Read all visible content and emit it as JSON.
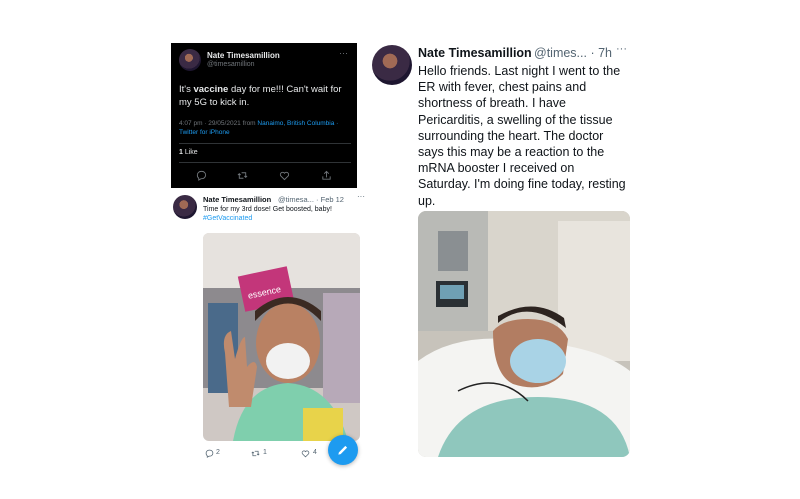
{
  "dark_tweet": {
    "name": "Nate Timesamillion",
    "handle": "@timesamillion",
    "text_before": "It's ",
    "text_bold": "vaccine",
    "text_after": " day for me!!! Can't wait for my 5G to kick in.",
    "meta_time": "4:07 pm · 29/05/2021 from ",
    "meta_location": "Nanaimo, British Columbia",
    "meta_source": " · Twitter for iPhone",
    "likes_count": "1",
    "likes_label": "Like",
    "more_icon": "more-icon"
  },
  "mid_tweet": {
    "name": "Nate Timesamillion",
    "handle": "@timesa... · Feb 12",
    "text": "Time for my 3rd dose! Get boosted, baby!",
    "hashtag": "#GetVaccinated",
    "photo_sign": "essence",
    "replies": "2",
    "retweets": "1",
    "likes": "4"
  },
  "right_tweet": {
    "name": "Nate Timesamillion",
    "handle": "@times... · 7h",
    "text": "Hello friends. Last night I went to the ER with fever, chest pains and shortness of breath. I have Pericarditis, a swelling of the tissue surrounding the heart. The doctor says this may be a reaction to the mRNA booster I received on Saturday. I'm doing fine today, resting up."
  },
  "colors": {
    "twitter_blue": "#1d9bf0",
    "dark_bg": "#000000",
    "text_dark": "#0f1419",
    "muted": "#536471"
  }
}
